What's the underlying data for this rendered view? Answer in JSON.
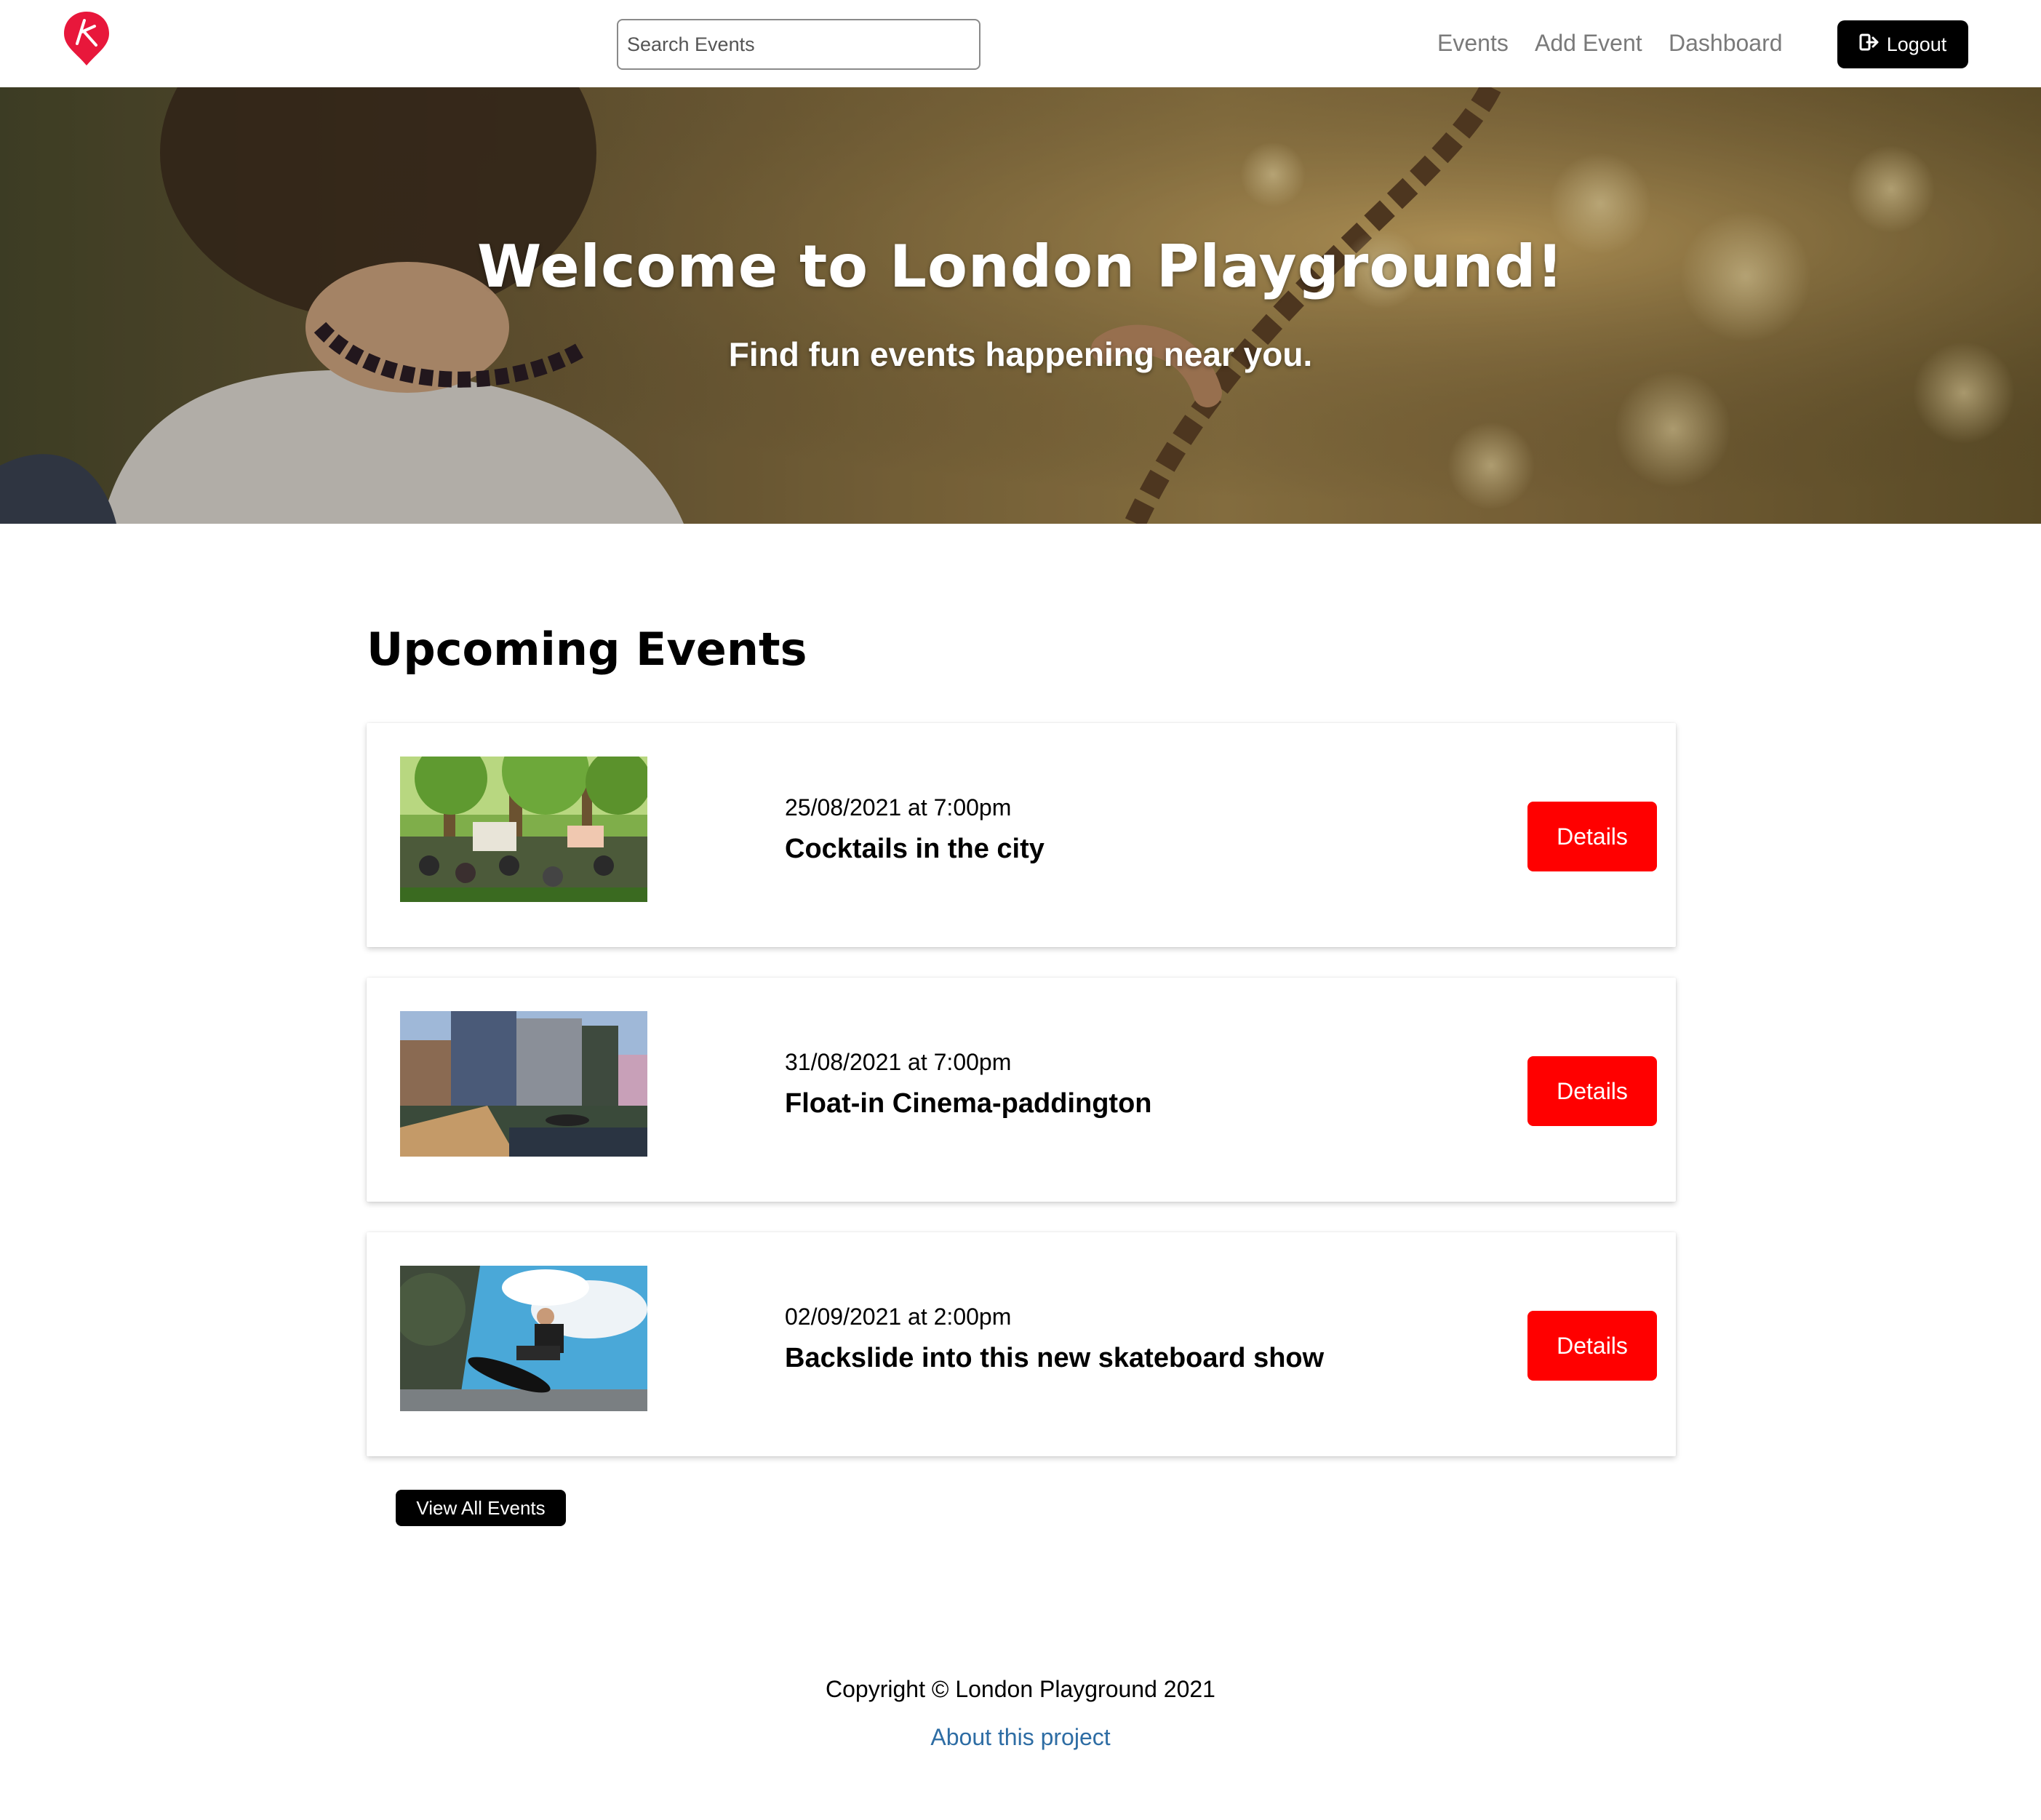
{
  "brand": {
    "accent": "#e8173b"
  },
  "navbar": {
    "search": {
      "placeholder": "Search Events",
      "value": ""
    },
    "links": [
      "Events",
      "Add Event",
      "Dashboard"
    ],
    "logout_label": "Logout"
  },
  "hero": {
    "title": "Welcome to London Playground!",
    "subtitle": "Find fun events happening near you."
  },
  "events_section": {
    "title": "Upcoming Events",
    "items": [
      {
        "date": "25/08/2021 at 7:00pm",
        "title": "Cocktails in the city",
        "button": "Details"
      },
      {
        "date": "31/08/2021 at 7:00pm",
        "title": "Float-in Cinema-paddington",
        "button": "Details"
      },
      {
        "date": "02/09/2021 at 2:00pm",
        "title": "Backslide into this new skateboard show",
        "button": "Details"
      }
    ],
    "view_all_label": "View All Events"
  },
  "footer": {
    "copyright": "Copyright © London Playground 2021",
    "about_link": "About this project"
  },
  "colors": {
    "details_button": "#ff0000",
    "logout_button": "#000000",
    "link": "#2e6da4"
  }
}
